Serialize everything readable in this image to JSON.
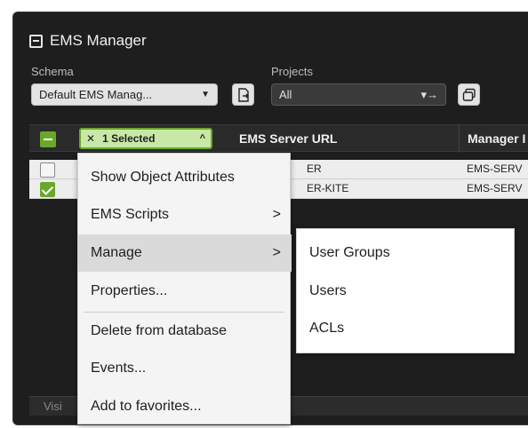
{
  "panel": {
    "title": "EMS Manager"
  },
  "filters": {
    "schema_label": "Schema",
    "schema_value": "Default EMS Manag...",
    "projects_label": "Projects",
    "projects_value": "All"
  },
  "table": {
    "selected_label": "1 Selected",
    "columns": [
      "EMS Server URL",
      "Manager I"
    ],
    "rows": [
      {
        "url": "ER",
        "manager": "EMS-SERV",
        "checked": false
      },
      {
        "url": "ER-KITE",
        "manager": "EMS-SERV",
        "checked": true
      }
    ],
    "footer_text": "Visi"
  },
  "context_menu": {
    "items": [
      {
        "label": "Show Object Attributes",
        "submenu": false
      },
      {
        "label": "EMS Scripts",
        "submenu": true
      },
      {
        "label": "Manage",
        "submenu": true,
        "active": true
      },
      {
        "label": "Properties...",
        "submenu": false
      },
      {
        "label": "Delete from database",
        "submenu": false
      },
      {
        "label": "Events...",
        "submenu": false
      },
      {
        "label": "Add to favorites...",
        "submenu": false
      }
    ],
    "chevron": ">"
  },
  "submenu": {
    "items": [
      "User Groups",
      "Users",
      "ACLs"
    ]
  },
  "colors": {
    "accent": "#6aa72b",
    "panel_bg": "#1e1e1e"
  }
}
